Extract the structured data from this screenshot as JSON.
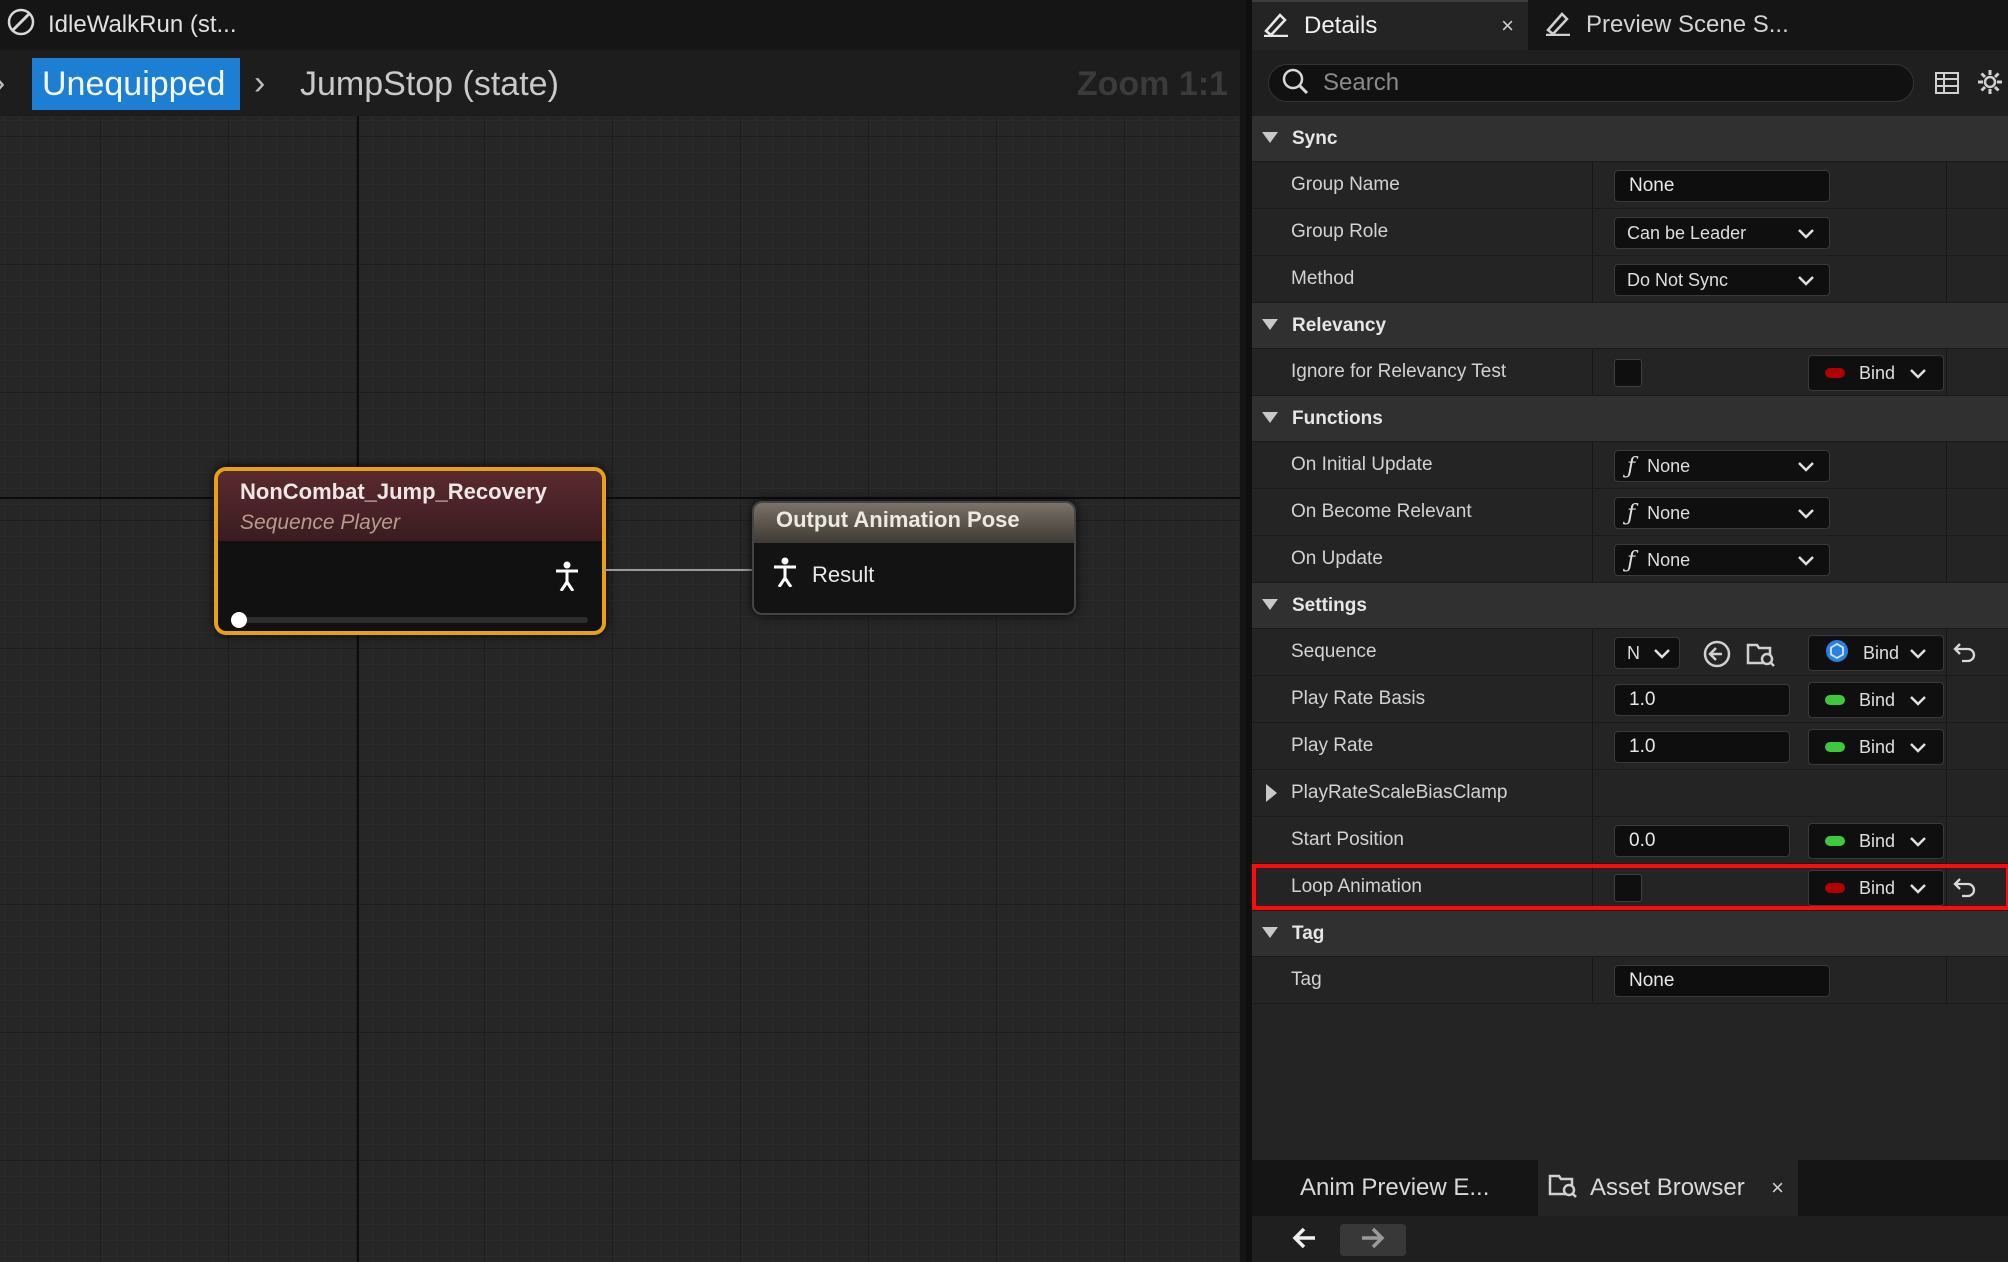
{
  "document_tab": {
    "title": "IdleWalkRun (st..."
  },
  "breadcrumb": {
    "items": [
      "Unequipped",
      "JumpStop (state)"
    ],
    "zoom": "Zoom 1:1"
  },
  "graph": {
    "node_sequence": {
      "title": "NonCombat_Jump_Recovery",
      "subtitle": "Sequence Player"
    },
    "node_output": {
      "title": "Output Animation Pose",
      "pin_label": "Result"
    }
  },
  "panel_tabs": {
    "details": "Details",
    "preview_scene": "Preview Scene S...",
    "close_glyph": "×"
  },
  "search": {
    "placeholder": "Search"
  },
  "sections": {
    "sync": {
      "label": "Sync",
      "group_name": {
        "label": "Group Name",
        "value": "None"
      },
      "group_role": {
        "label": "Group Role",
        "value": "Can be Leader"
      },
      "method": {
        "label": "Method",
        "value": "Do Not Sync"
      }
    },
    "relevancy": {
      "label": "Relevancy",
      "ignore": {
        "label": "Ignore for Relevancy Test",
        "checked": false,
        "bind": "Bind"
      }
    },
    "functions": {
      "label": "Functions",
      "initial_update": {
        "label": "On Initial Update",
        "value": "None"
      },
      "become_relevant": {
        "label": "On Become Relevant",
        "value": "None"
      },
      "on_update": {
        "label": "On Update",
        "value": "None"
      }
    },
    "settings": {
      "label": "Settings",
      "sequence": {
        "label": "Sequence",
        "value": "N",
        "bind": "Bind"
      },
      "play_rate_basis": {
        "label": "Play Rate Basis",
        "value": "1.0",
        "bind": "Bind"
      },
      "play_rate": {
        "label": "Play Rate",
        "value": "1.0",
        "bind": "Bind"
      },
      "scale_bias_clamp": {
        "label": "PlayRateScaleBiasClamp"
      },
      "start_position": {
        "label": "Start Position",
        "value": "0.0",
        "bind": "Bind"
      },
      "loop_animation": {
        "label": "Loop Animation",
        "checked": false,
        "bind": "Bind"
      }
    },
    "tag": {
      "label": "Tag",
      "tag": {
        "label": "Tag",
        "value": "None"
      }
    }
  },
  "bottom_tabs": {
    "anim_preview": "Anim Preview E...",
    "asset_browser": "Asset Browser"
  },
  "colors": {
    "accent_blue": "#1d7fd4",
    "bool_pin_red": "#b00000",
    "float_pin_green": "#3ec83e",
    "highlight_red": "#ff0a0a",
    "node_selected_orange": "#e8a014"
  }
}
